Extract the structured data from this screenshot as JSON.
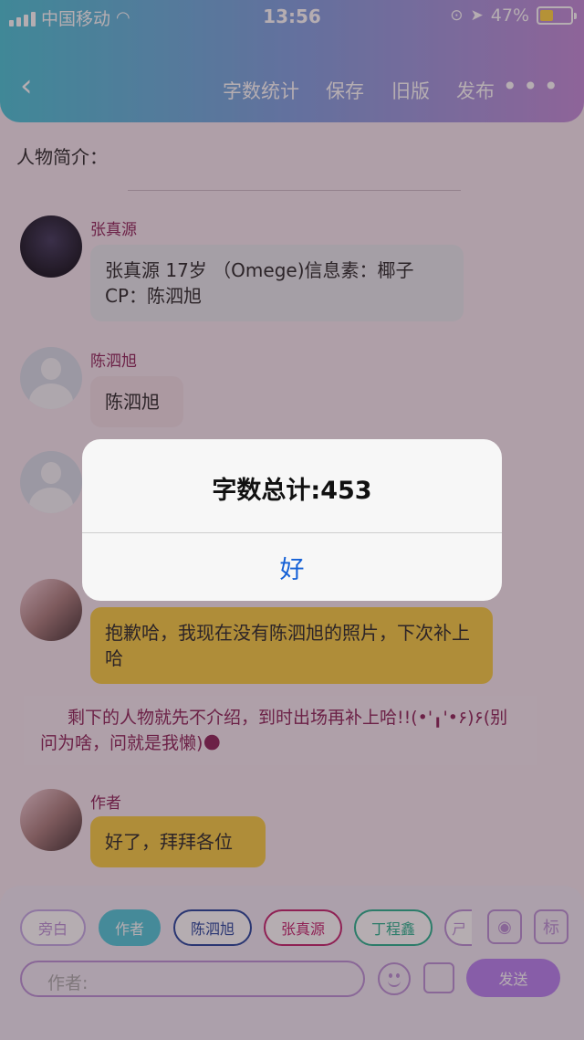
{
  "status_bar": {
    "carrier": "中国移动",
    "time": "13:56",
    "battery": "47%"
  },
  "nav": {
    "back_icon": "chevron-left-icon",
    "items": [
      "字数统计",
      "保存",
      "旧版",
      "发布"
    ],
    "more": "•••"
  },
  "intro_label": "人物简介：",
  "messages": [
    {
      "name": "张真源",
      "text": "张真源 17岁 （Omege)信息素：椰子CP：陈泗旭"
    },
    {
      "name": "陈泗旭",
      "text": "陈泗旭"
    },
    {
      "name": "",
      "text": "抱歉哈，我现在没有陈泗旭的照片，下次补上哈"
    },
    {
      "name": "作者",
      "text": "好了，拜拜各位"
    }
  ],
  "narration": "剩下的人物就先不介绍，到时出场再补上哈!!(•'╻'•۶)۶(别问为啥，问就是我懒)🌑",
  "chips": [
    "旁白",
    "作者",
    "陈泗旭",
    "张真源",
    "丁程鑫",
    "ㄕ"
  ],
  "icons": {
    "contact": "person-card-icon",
    "tag": "标"
  },
  "input_placeholder": "作者:",
  "send_label": "发送",
  "alert": {
    "title": "字数总计:453",
    "button": "好"
  },
  "colors": {
    "accent": "#b57ef0",
    "name_color": "#8a1e54",
    "alert_button": "#1460d6"
  }
}
